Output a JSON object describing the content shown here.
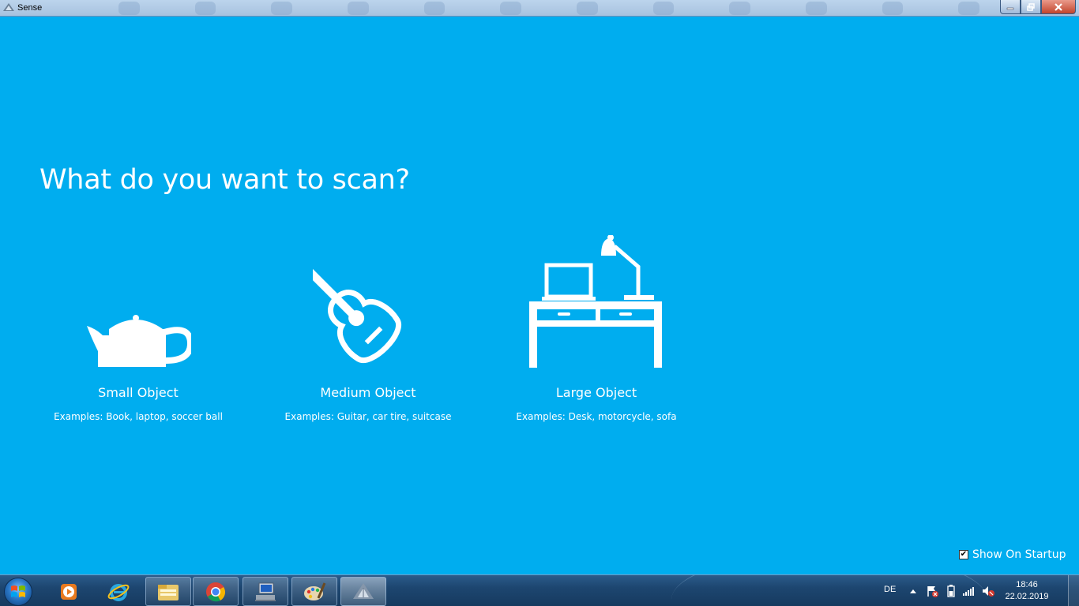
{
  "window": {
    "title": "Sense",
    "controls": {
      "minimize": "minimize",
      "maximize": "restore",
      "close": "close"
    }
  },
  "main": {
    "heading": "What do you want to scan?",
    "options": [
      {
        "title": "Small Object",
        "examples": "Examples: Book, laptop, soccer ball",
        "icon": "teapot-icon"
      },
      {
        "title": "Medium Object",
        "examples": "Examples: Guitar, car tire, suitcase",
        "icon": "guitar-icon"
      },
      {
        "title": "Large Object",
        "examples": "Examples: Desk, motorcycle, sofa",
        "icon": "desk-icon"
      }
    ],
    "startup": {
      "label": "Show On Startup",
      "checked": true
    }
  },
  "taskbar": {
    "items": [
      "windows-media-player-icon",
      "internet-explorer-icon",
      "file-explorer-icon",
      "chrome-icon",
      "network-computer-icon",
      "paint-icon",
      "sense-icon"
    ],
    "language": "DE",
    "time": "18:46",
    "date": "22.02.2019"
  },
  "colors": {
    "background": "#00adef",
    "text": "#ffffff",
    "taskbar": "#1d4670"
  }
}
